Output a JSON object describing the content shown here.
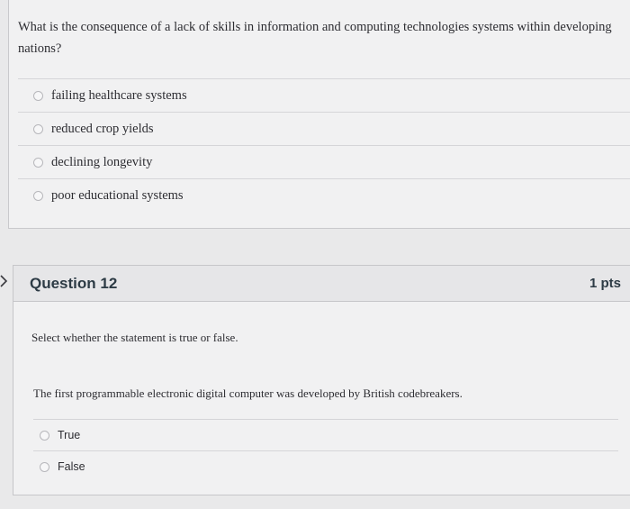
{
  "question11": {
    "text": "What is the consequence of a lack of skills in information and computing technologies systems within developing nations?",
    "answers": [
      {
        "label": "failing healthcare systems"
      },
      {
        "label": "reduced crop yields"
      },
      {
        "label": "declining longevity"
      },
      {
        "label": "poor educational systems"
      }
    ]
  },
  "question12": {
    "title": "Question 12",
    "points": "1 pts",
    "instruction": "Select whether the statement is true or false.",
    "statement": "The first programmable electronic digital computer was developed by British codebreakers.",
    "answers": [
      {
        "label": "True"
      },
      {
        "label": "False"
      }
    ]
  },
  "icons": {
    "collapse": "chevron-right-icon",
    "radio": "radio-unchecked-icon"
  }
}
